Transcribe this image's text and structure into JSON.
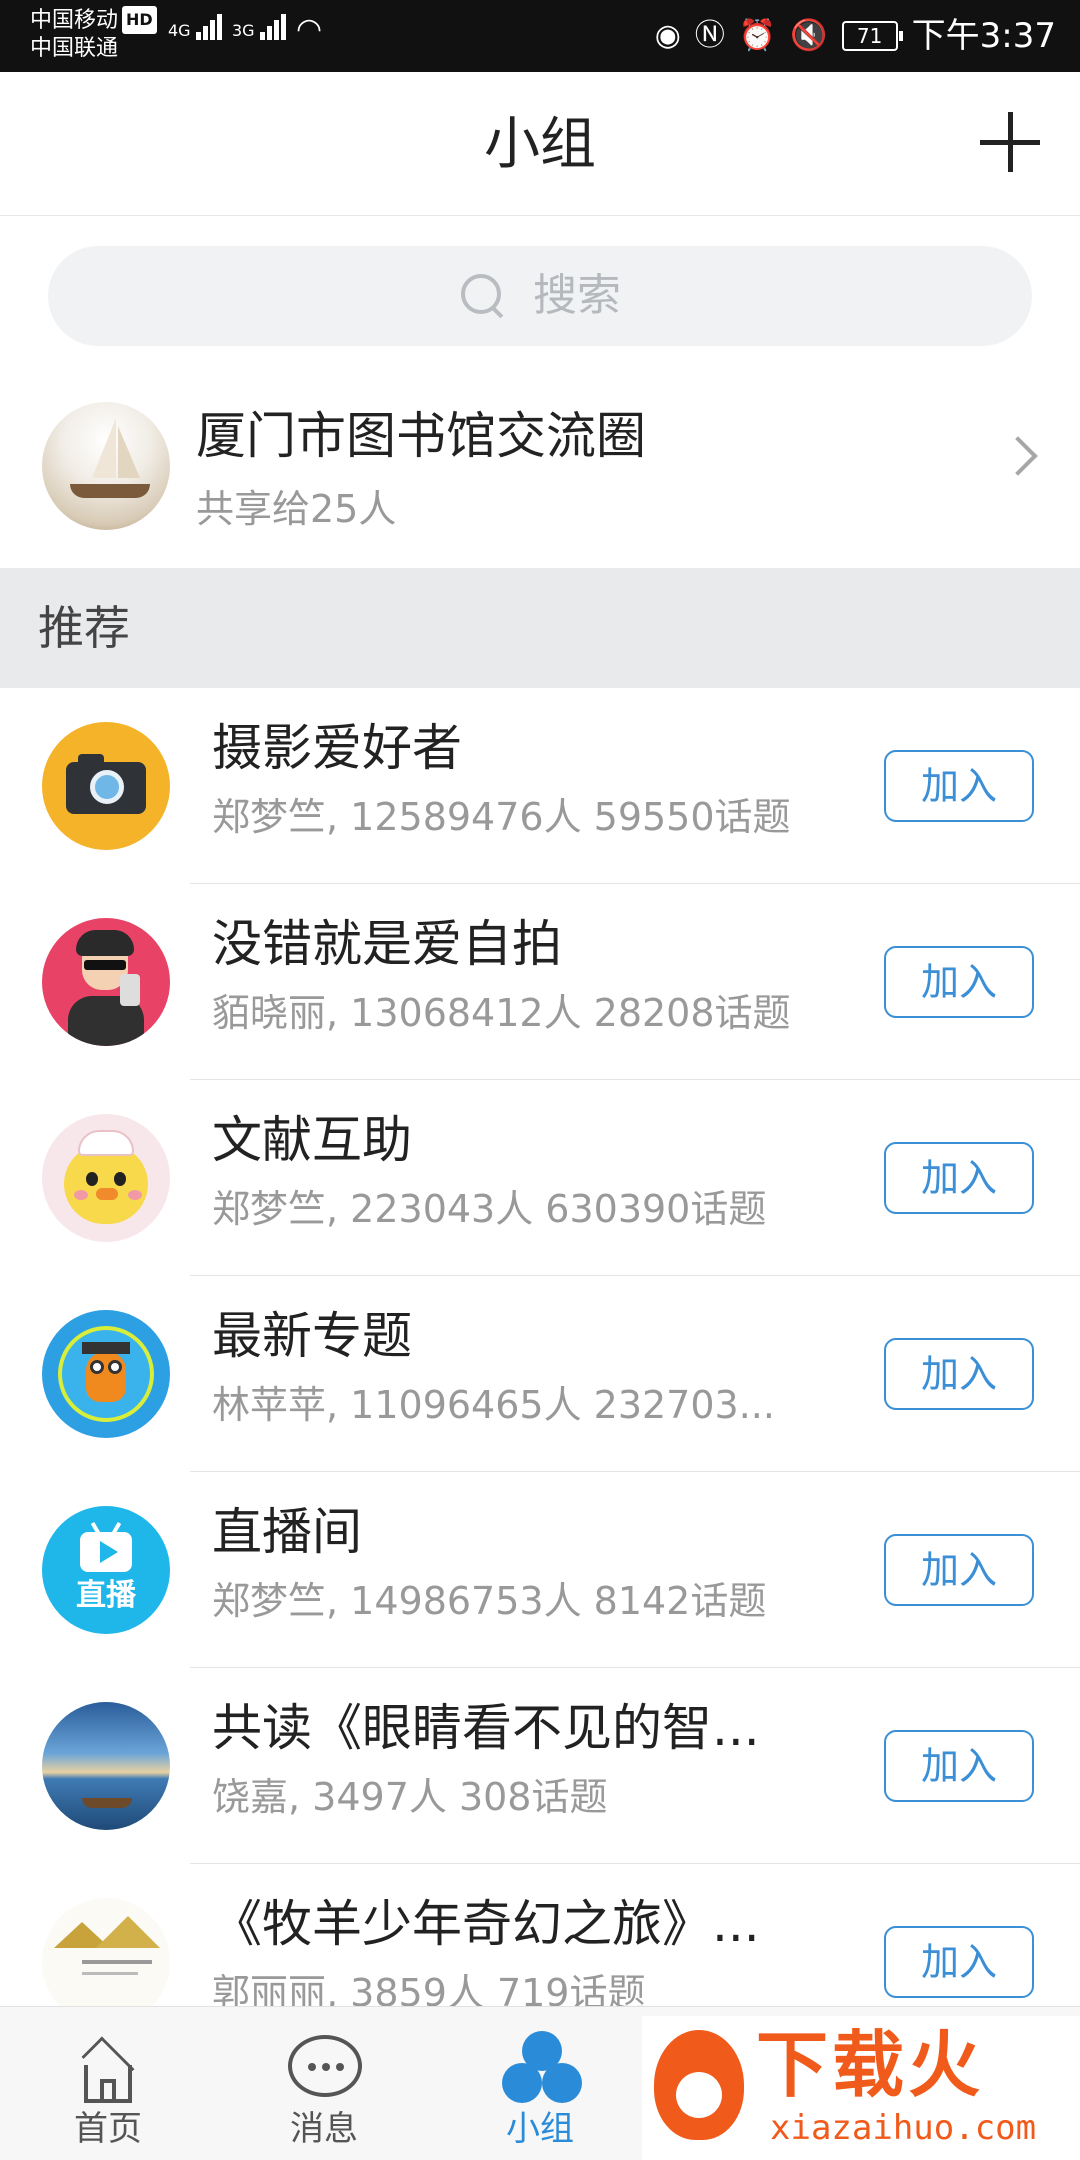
{
  "status_bar": {
    "carrier1": "中国移动",
    "carrier1_badge": "HD",
    "carrier2": "中国联通",
    "signal1_label": "4G",
    "signal2_label": "3G",
    "battery": "71",
    "time": "下午3:37"
  },
  "header": {
    "title": "小组"
  },
  "search": {
    "placeholder": "搜索"
  },
  "my_group": {
    "name": "厦门市图书馆交流圈",
    "shared": "共享给25人"
  },
  "section": {
    "label": "推荐"
  },
  "groups": [
    {
      "name": "摄影爱好者",
      "info": "郑梦竺, 12589476人 59550话题",
      "join": "加入"
    },
    {
      "name": "没错就是爱自拍",
      "info": "貊晓丽, 13068412人 28208话题",
      "join": "加入"
    },
    {
      "name": "文献互助",
      "info": "郑梦竺, 223043人 630390话题",
      "join": "加入"
    },
    {
      "name": "最新专题",
      "info": "林苹苹, 11096465人 232703...",
      "join": "加入"
    },
    {
      "name": "直播间",
      "info": "郑梦竺, 14986753人 8142话题",
      "join": "加入",
      "avatar_text": "直播"
    },
    {
      "name": "共读《眼睛看不见的智...",
      "info": "饶嘉, 3497人 308话题",
      "join": "加入"
    },
    {
      "name": "《牧羊少年奇幻之旅》...",
      "info": "郭丽丽, 3859人 719话题",
      "join": "加入"
    }
  ],
  "bottom_nav": {
    "tabs": [
      {
        "label": "首页"
      },
      {
        "label": "消息"
      },
      {
        "label": "小组"
      }
    ]
  },
  "watermark": {
    "title": "下载火",
    "url": "xiazaihuo.com"
  },
  "colors": {
    "accent": "#2a8bd8",
    "join_border": "#3a8fd6",
    "section_bg": "#e9eaec"
  }
}
